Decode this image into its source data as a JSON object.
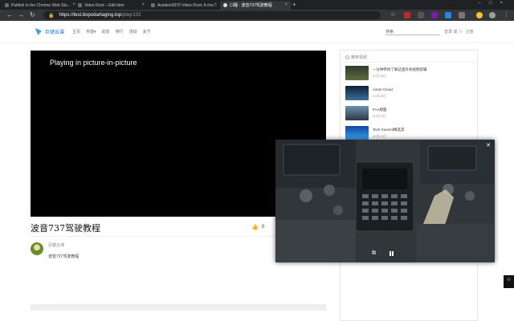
{
  "browser": {
    "tabs": [
      {
        "title": "Publish in the Chrome Web Sto...",
        "active": false
      },
      {
        "title": "Video Root – Edit item",
        "active": false
      },
      {
        "title": "Aviation3070 Video Root: A che...",
        "active": false
      },
      {
        "title": "口睡 · 波音737驾驶教程",
        "active": true
      }
    ],
    "url_host": "https://test.bopodartaging.top",
    "url_path": "/play/132"
  },
  "site": {
    "logo": "巨键云课",
    "nav": [
      "主页",
      "专题▾",
      "动态",
      "排行",
      "活动",
      "关于"
    ],
    "search_placeholder": "搜索",
    "login": "登录",
    "or": "或",
    "register": "注册"
  },
  "player": {
    "pip_message": "Playing in picture-in-picture"
  },
  "video": {
    "title": "波音737驾驶教程",
    "likes": "0",
    "author": "巨键云课",
    "description": "波音737驾驶教程"
  },
  "sidebar": {
    "title": "推荐视频",
    "items": [
      {
        "title": "一分钟带你了解这直升机视频剪辑",
        "date": "00月28日",
        "thumb_color": "#3b4d2f"
      },
      {
        "title": "Azure Cloud",
        "date": "00月28日",
        "thumb_color": "#1e3a5f"
      },
      {
        "title": "FAA舱面",
        "date": "00月19日",
        "thumb_color": "#4f6d8a"
      },
      {
        "title": "Tech Summit精选其",
        "date": "00月19日",
        "thumb_color": "#1565c0"
      }
    ]
  },
  "pip": {
    "close": "✕",
    "back_to_tab": "⧉"
  },
  "colors": {
    "accent": "#1976d2",
    "page_bg": "#ffffff"
  }
}
